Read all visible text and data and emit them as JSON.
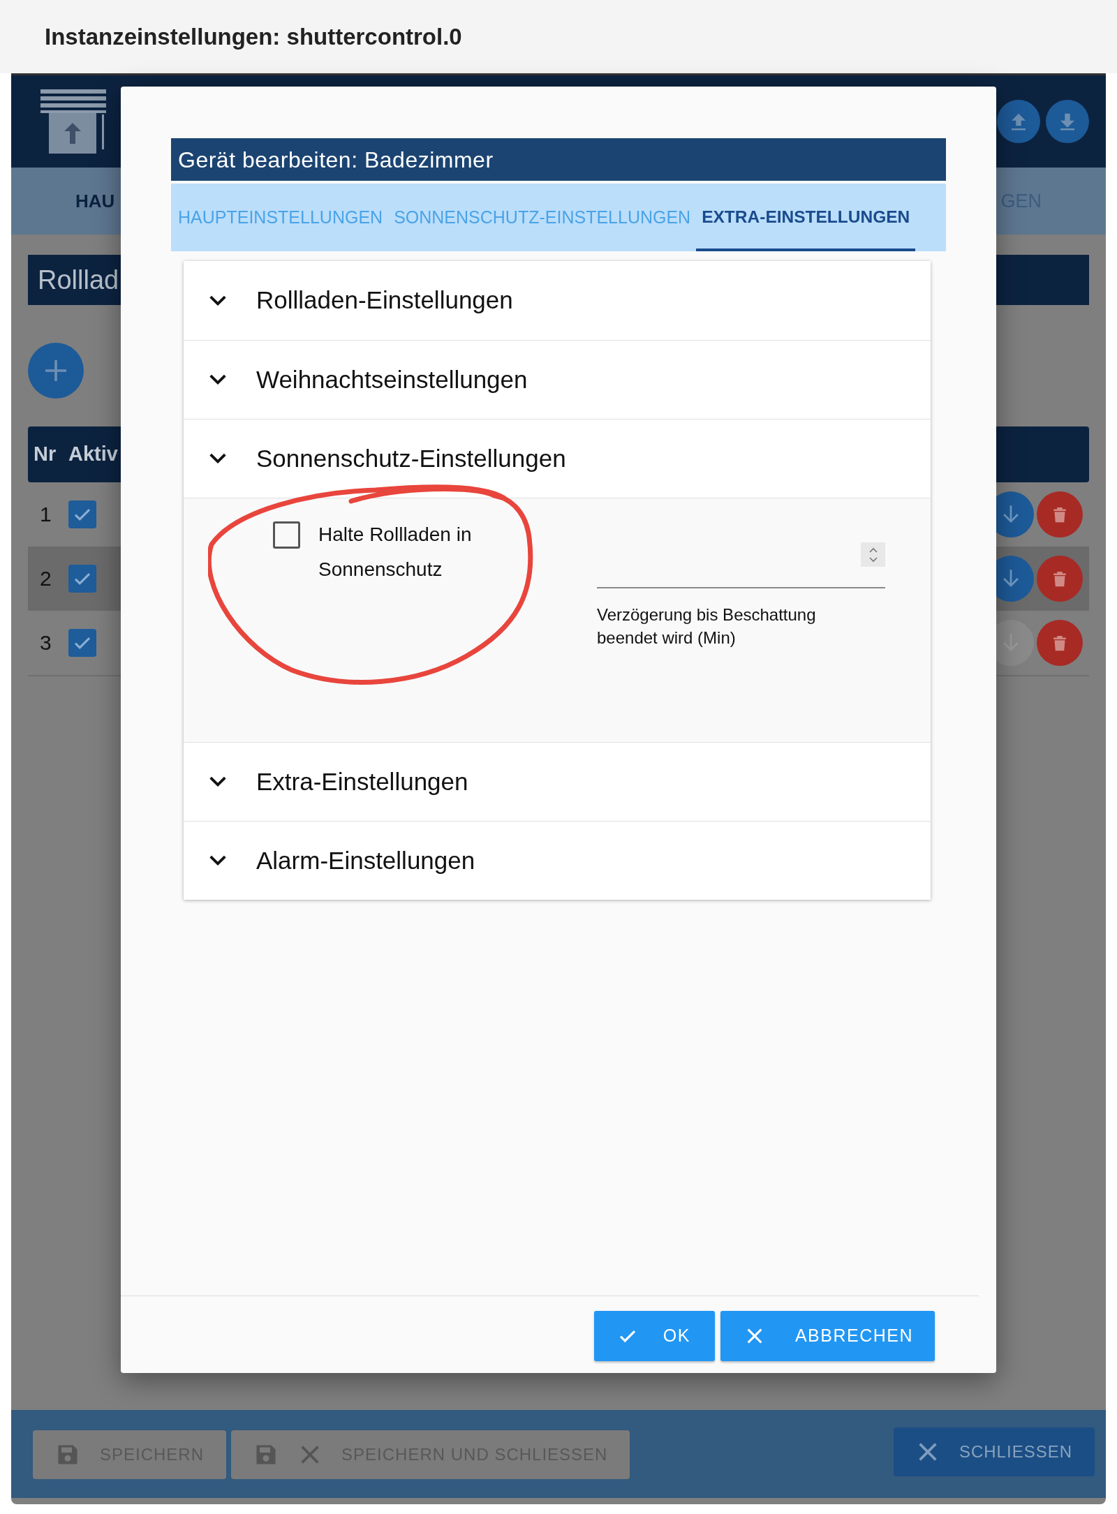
{
  "window": {
    "title": "Instanzeinstellungen: shuttercontrol.0"
  },
  "app": {
    "tabs": [
      {
        "label": "HAU",
        "selected": true
      },
      {
        "label": "GEN",
        "selected": false
      }
    ],
    "section_title": "Rolllad",
    "table": {
      "columns": [
        "Nr",
        "Aktiv"
      ],
      "rows": [
        {
          "nr": "1",
          "active": true,
          "selected": false,
          "download_disabled": false
        },
        {
          "nr": "2",
          "active": true,
          "selected": true,
          "download_disabled": false
        },
        {
          "nr": "3",
          "active": true,
          "selected": false,
          "download_disabled": true
        }
      ]
    },
    "footer_buttons": [
      {
        "label": "SPEICHERN",
        "kind": "save",
        "disabled": true
      },
      {
        "label": "SPEICHERN UND SCHLIESSEN",
        "kind": "save_close",
        "disabled": true
      },
      {
        "label": "SCHLIESSEN",
        "kind": "close",
        "disabled": false
      }
    ]
  },
  "dialog": {
    "title": "Gerät bearbeiten: Badezimmer",
    "tabs": [
      {
        "label": "HAUPTEINSTELLUNGEN",
        "selected": false
      },
      {
        "label": "SONNENSCHUTZ-EINSTELLUNGEN",
        "selected": false
      },
      {
        "label": "EXTRA-EINSTELLUNGEN",
        "selected": true
      }
    ],
    "sections": [
      {
        "title": "Rollladen-Einstellungen",
        "expanded": false
      },
      {
        "title": "Weihnachtseinstellungen",
        "expanded": false
      },
      {
        "title": "Sonnenschutz-Einstellungen",
        "expanded": true,
        "fields": [
          {
            "kind": "checkbox",
            "label": "Halte Rollladen in Sonnenschutz",
            "checked": false
          },
          {
            "kind": "number",
            "label": "Verzögerung bis Beschattung beendet wird (Min)"
          }
        ]
      },
      {
        "title": "Extra-Einstellungen",
        "expanded": false
      },
      {
        "title": "Alarm-Einstellungen",
        "expanded": false
      }
    ],
    "buttons": [
      {
        "label": "OK",
        "kind": "ok"
      },
      {
        "label": "ABBRECHEN",
        "kind": "cancel"
      }
    ]
  },
  "annotation": {
    "kind": "circle"
  }
}
